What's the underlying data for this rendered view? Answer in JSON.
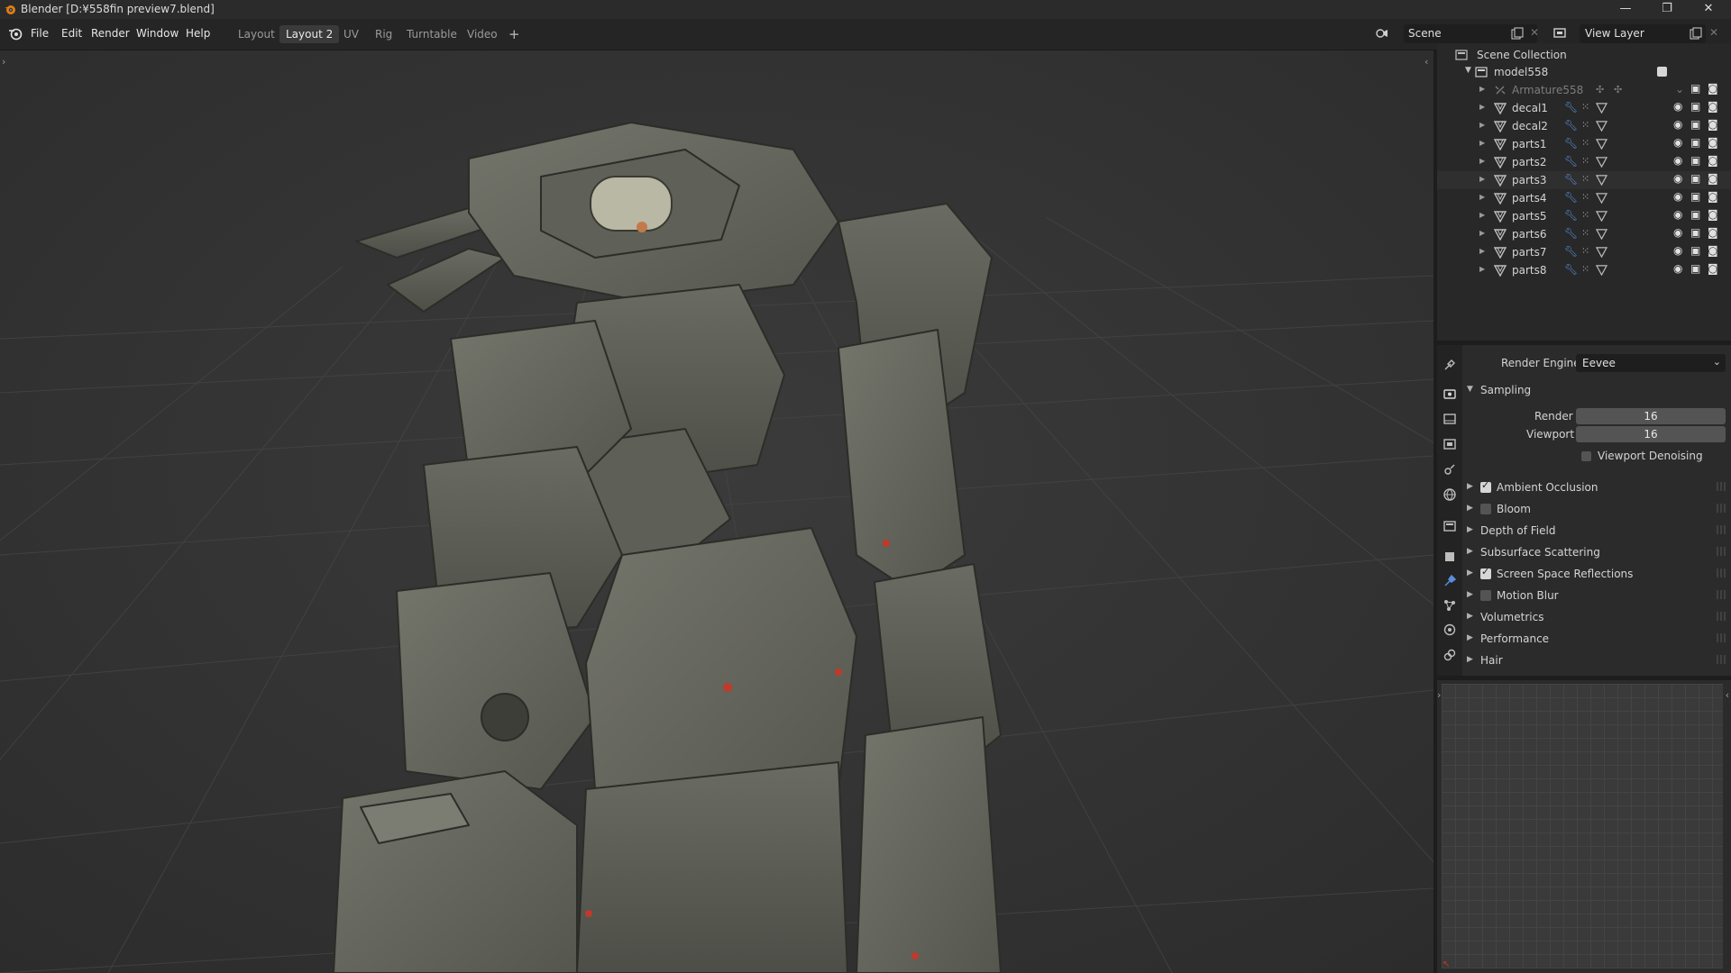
{
  "window": {
    "title": "Blender [D:¥558fin preview7.blend]",
    "controls": [
      "—",
      "❐",
      "✕"
    ]
  },
  "menu": [
    "File",
    "Edit",
    "Render",
    "Window",
    "Help"
  ],
  "workspaces": {
    "tabs": [
      "Layout",
      "Layout 2",
      "UV",
      "Rig",
      "Turntable",
      "Video"
    ],
    "active_index": 1,
    "add": "+"
  },
  "scene": {
    "name": "Scene",
    "view_layer": "View Layer"
  },
  "outliner": {
    "root": "Scene Collection",
    "collection": "model558",
    "items": [
      {
        "name": "Armature558",
        "type": "armature",
        "dim": true
      },
      {
        "name": "decal1",
        "type": "mesh"
      },
      {
        "name": "decal2",
        "type": "mesh"
      },
      {
        "name": "parts1",
        "type": "mesh"
      },
      {
        "name": "parts2",
        "type": "mesh"
      },
      {
        "name": "parts3",
        "type": "mesh"
      },
      {
        "name": "parts4",
        "type": "mesh"
      },
      {
        "name": "parts5",
        "type": "mesh"
      },
      {
        "name": "parts6",
        "type": "mesh"
      },
      {
        "name": "parts7",
        "type": "mesh"
      },
      {
        "name": "parts8",
        "type": "mesh"
      }
    ]
  },
  "properties": {
    "render_engine_label": "Render Engine",
    "render_engine": "Eevee",
    "sampling": {
      "title": "Sampling",
      "render_label": "Render",
      "render": "16",
      "viewport_label": "Viewport",
      "viewport": "16",
      "denoise_label": "Viewport Denoising",
      "denoise_checked": false
    },
    "panels": [
      {
        "label": "Ambient Occlusion",
        "checkbox": true,
        "checked": true
      },
      {
        "label": "Bloom",
        "checkbox": true,
        "checked": false
      },
      {
        "label": "Depth of Field",
        "checkbox": false
      },
      {
        "label": "Subsurface Scattering",
        "checkbox": false
      },
      {
        "label": "Screen Space Reflections",
        "checkbox": true,
        "checked": true
      },
      {
        "label": "Motion Blur",
        "checkbox": true,
        "checked": false
      },
      {
        "label": "Volumetrics",
        "checkbox": false
      },
      {
        "label": "Performance",
        "checkbox": false
      },
      {
        "label": "Hair",
        "checkbox": false
      }
    ]
  },
  "colors": {
    "viewport_bg": "#363636",
    "panel_bg": "#2b2b2b",
    "model_base": "#5d5e55",
    "accent_light": "#5b8ed8",
    "marker_red": "#c0392b"
  }
}
